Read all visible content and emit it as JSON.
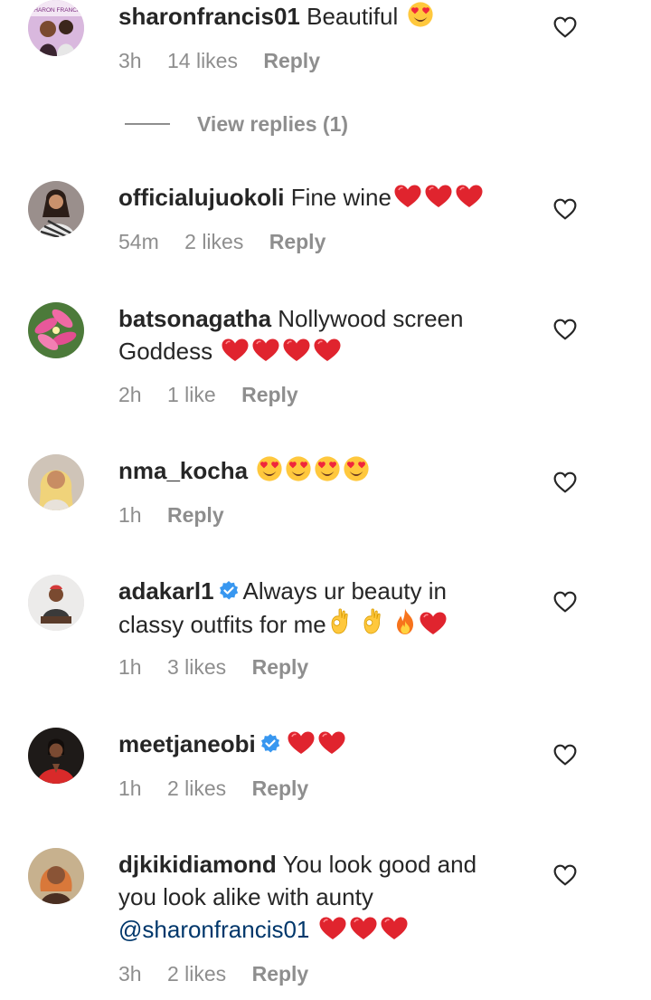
{
  "comments": [
    {
      "username": "sharonfrancis01",
      "text": "Beautiful",
      "time": "3h",
      "likes": "14 likes",
      "reply": "Reply",
      "avatar_banner": "SHARON FRANCIS"
    },
    {
      "username": "officialujuokoli",
      "text": "Fine wine",
      "time": "54m",
      "likes": "2 likes",
      "reply": "Reply"
    },
    {
      "username": "batsonagatha",
      "text": "Nollywood screen Goddess",
      "time": "2h",
      "likes": "1 like",
      "reply": "Reply"
    },
    {
      "username": "nma_kocha",
      "text": "",
      "time": "1h",
      "likes": "",
      "reply": "Reply"
    },
    {
      "username": "adakarl1",
      "text": "Always ur beauty in classy outfits for me",
      "time": "1h",
      "likes": "3 likes",
      "reply": "Reply"
    },
    {
      "username": "meetjaneobi",
      "text": "",
      "time": "1h",
      "likes": "2 likes",
      "reply": "Reply"
    },
    {
      "username": "djkikidiamond",
      "text": "You look good and you look alike with aunty",
      "mention": "@sharonfrancis01",
      "time": "3h",
      "likes": "2 likes",
      "reply": "Reply"
    }
  ],
  "view_replies": {
    "label": "View replies (1)"
  },
  "icons": {
    "like": "heart-outline-icon",
    "verified": "verified-badge-icon",
    "heart_emoji": "red-heart-emoji",
    "heart_eyes": "heart-eyes-emoji",
    "ok_hand": "ok-hand-emoji",
    "fire": "fire-emoji"
  },
  "colors": {
    "text": "#262626",
    "meta": "#8e8e8e",
    "mention": "#00376b",
    "verified": "#3897f0",
    "heart_emoji": "#e0242e"
  }
}
